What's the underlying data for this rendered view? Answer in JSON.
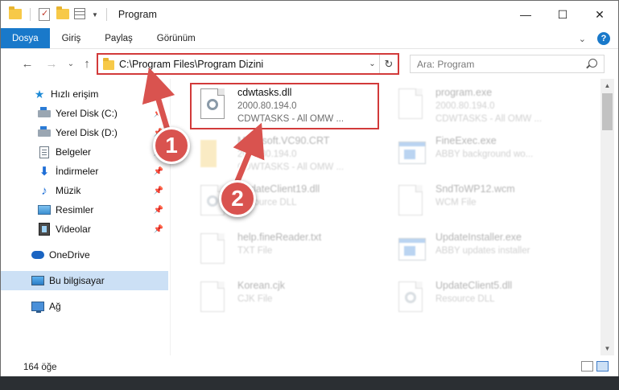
{
  "window": {
    "title": "Program",
    "controls": {
      "minimize": "—",
      "maximize": "☐",
      "close": "✕"
    }
  },
  "ribbon": {
    "tabs": [
      "Dosya",
      "Giriş",
      "Paylaş",
      "Görünüm"
    ],
    "expand": "⌄",
    "help": "?"
  },
  "address": {
    "path": "C:\\Program Files\\Program Dizini",
    "search_placeholder": "Ara: Program"
  },
  "nav": {
    "back": "←",
    "forward": "→",
    "recent": "⌄",
    "up": "↑",
    "refresh": "↻",
    "dropdown": "⌄"
  },
  "sidebar": {
    "items": [
      {
        "label": "Hızlı erişim",
        "icon": "star-icon"
      },
      {
        "label": "Yerel Disk (C:)",
        "icon": "drive-icon",
        "pinned": true
      },
      {
        "label": "Yerel Disk (D:)",
        "icon": "drive-icon",
        "pinned": true
      },
      {
        "label": "Belgeler",
        "icon": "documents-icon",
        "pinned": true
      },
      {
        "label": "İndirmeler",
        "icon": "downloads-icon",
        "pinned": true
      },
      {
        "label": "Müzik",
        "icon": "music-icon",
        "pinned": true
      },
      {
        "label": "Resimler",
        "icon": "pictures-icon",
        "pinned": true
      },
      {
        "label": "Videolar",
        "icon": "videos-icon",
        "pinned": true
      },
      {
        "label": "OneDrive",
        "icon": "onedrive-icon"
      },
      {
        "label": "Bu bilgisayar",
        "icon": "this-pc-icon",
        "selected": true
      },
      {
        "label": "Ağ",
        "icon": "network-icon"
      }
    ]
  },
  "files": [
    {
      "name": "cdwtasks.dll",
      "line1": "2000.80.194.0",
      "line2": "CDWTASKS - All OMW ...",
      "icon": "dll-file-icon",
      "highlighted": true
    },
    {
      "name": "program.exe",
      "line1": "2000.80.194.0",
      "line2": "CDWTASKS - All OMW ...",
      "icon": "exe-file-icon"
    },
    {
      "name": "Microsoft.VC90.CRT",
      "line1": "2000.80.194.0",
      "line2": "CDWTASKS - All OMW ...",
      "icon": "folder-icon"
    },
    {
      "name": "FineExec.exe",
      "line1": "ABBY background wo...",
      "line2": "",
      "icon": "exe-file-icon"
    },
    {
      "name": "UpdateClient19.dll",
      "line1": "Resource DLL",
      "line2": "",
      "icon": "dll-file-icon"
    },
    {
      "name": "SndToWP12.wcm",
      "line1": "WCM File",
      "line2": "",
      "icon": "generic-file-icon"
    },
    {
      "name": "help.fineReader.txt",
      "line1": "TXT File",
      "line2": "",
      "icon": "txt-file-icon"
    },
    {
      "name": "UpdateInstaller.exe",
      "line1": "ABBY updates installer",
      "line2": "",
      "icon": "exe-file-icon"
    },
    {
      "name": "Korean.cjk",
      "line1": "CJK File",
      "line2": "",
      "icon": "generic-file-icon"
    },
    {
      "name": "UpdateClient5.dll",
      "line1": "Resource DLL",
      "line2": "",
      "icon": "dll-file-icon"
    }
  ],
  "status": {
    "count": "164 öğe"
  },
  "annotations": {
    "step1": "1",
    "step2": "2",
    "accent": "#d23a3a"
  }
}
